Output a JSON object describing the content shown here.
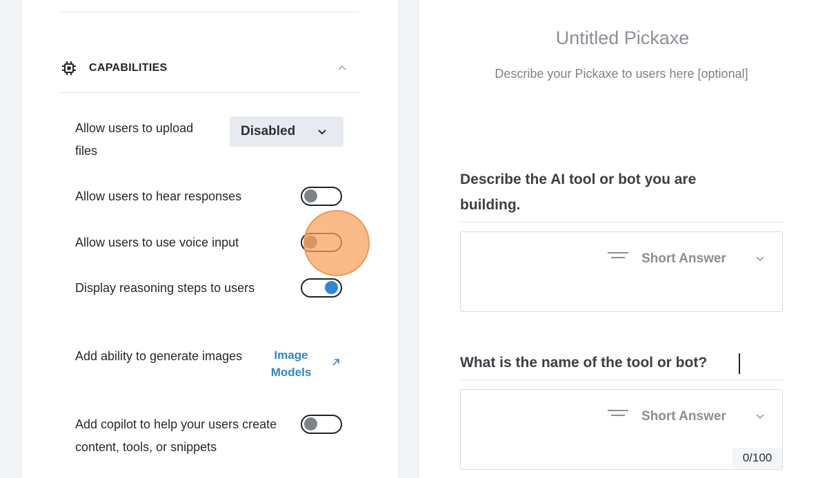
{
  "capabilities": {
    "title": "CAPABILITIES",
    "icon": "cpu-chip-icon",
    "upload_files": {
      "label": "Allow users to upload files",
      "value": "Disabled"
    },
    "hear_responses": {
      "label": "Allow users to hear responses",
      "enabled": false
    },
    "voice_input": {
      "label": "Allow users to use voice input",
      "enabled": false
    },
    "reasoning_steps": {
      "label": "Display reasoning steps to users",
      "enabled": true
    },
    "generate_images": {
      "label": "Add ability to generate images",
      "link": "Image Models"
    },
    "copilot": {
      "label": "Add copilot to help your users create content, tools, or snippets",
      "enabled": false
    }
  },
  "preview": {
    "title": "Untitled Pickaxe",
    "description": "Describe your Pickaxe to users here [optional]",
    "questions": [
      {
        "text": "Describe the AI tool or bot you are building.",
        "answer_type": "Short Answer"
      },
      {
        "text": "What is the name of the tool or bot?",
        "answer_type": "Short Answer",
        "char_count": "0/100"
      }
    ]
  },
  "colors": {
    "accent": "#2f86d6",
    "link": "#2f86c8",
    "click_highlight": "#f8a05c"
  }
}
